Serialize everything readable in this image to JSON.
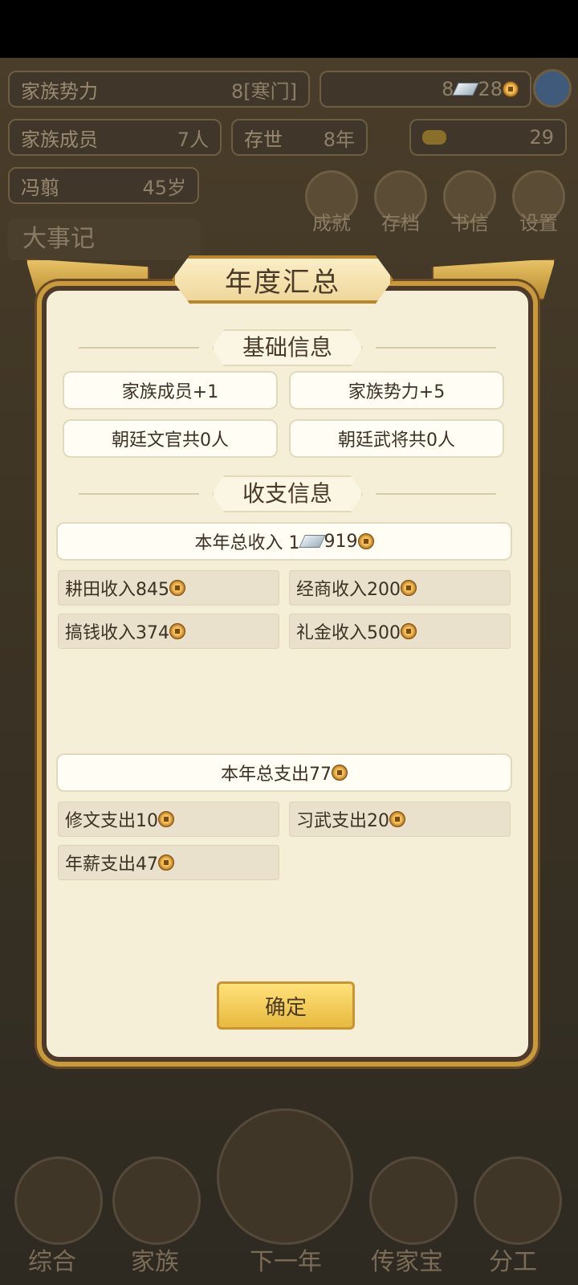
{
  "background": {
    "family_power_label": "家族势力",
    "family_power_value": "8[寒门]",
    "silver_value": "8",
    "copper_value": "28",
    "family_members_label": "家族成员",
    "family_members_value": "7人",
    "existence_label": "存世",
    "existence_value": "8年",
    "gold_value": "29",
    "head_name": "冯翦",
    "head_age": "45岁",
    "buttons": [
      "成就",
      "存档",
      "书信",
      "设置"
    ],
    "events_tab": "大事记",
    "nav": [
      "综合",
      "家族",
      "下一年",
      "传家宝",
      "分工"
    ]
  },
  "dialog": {
    "title": "年度汇总",
    "basic_section": "基础信息",
    "basic_items": [
      "家族成员+1",
      "家族势力+5",
      "朝廷文官共0人",
      "朝廷武将共0人"
    ],
    "finance_section": "收支信息",
    "income_total_label": "本年总收入 1",
    "income_total_value": "919",
    "income_items": [
      "耕田收入845",
      "经商收入200",
      "搞钱收入374",
      "礼金收入500"
    ],
    "expense_total_label": "本年总支出77",
    "expense_items": [
      "修文支出10",
      "习武支出20",
      "年薪支出47"
    ],
    "confirm_button": "确定"
  }
}
